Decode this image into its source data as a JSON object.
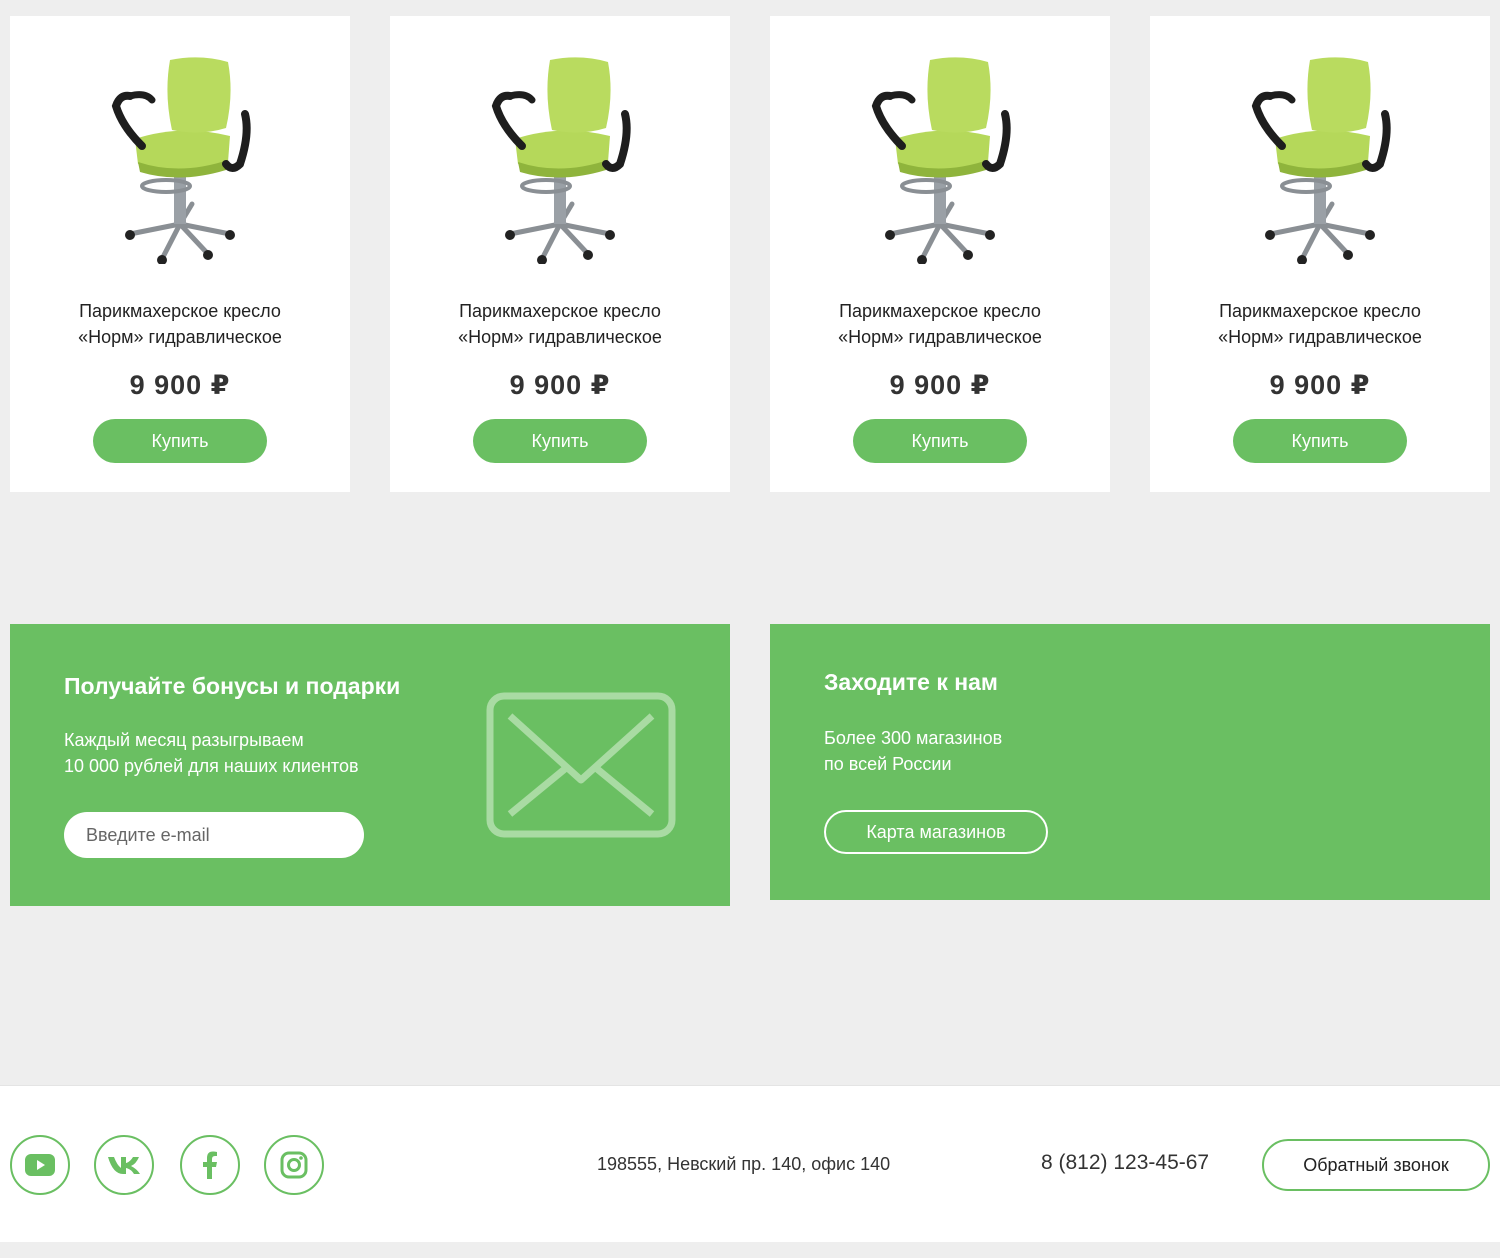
{
  "colors": {
    "accent": "#6abf62",
    "background": "#eeeeee"
  },
  "products": [
    {
      "title": "Парикмахерское кресло\n«Норм» гидравлическое",
      "price": "9 900 ₽",
      "buy_label": "Купить",
      "image": "green-chair-image"
    },
    {
      "title": "Парикмахерское кресло\n«Норм» гидравлическое",
      "price": "9 900 ₽",
      "buy_label": "Купить",
      "image": "green-chair-image"
    },
    {
      "title": "Парикмахерское кресло\n«Норм» гидравлическое",
      "price": "9 900 ₽",
      "buy_label": "Купить",
      "image": "green-chair-image"
    },
    {
      "title": "Парикмахерское кресло\n«Норм» гидравлическое",
      "price": "9 900 ₽",
      "buy_label": "Купить",
      "image": "green-chair-image"
    }
  ],
  "bonus_promo": {
    "title": "Получайте бонусы и подарки",
    "text": "Каждый месяц разыгрываем\n10 000 рублей для наших клиентов",
    "email_placeholder": "Введите e-mail",
    "icon": "envelope-icon"
  },
  "stores_promo": {
    "title": "Заходите к нам",
    "text": "Более 300 магазинов\nпо всей России",
    "button_label": "Карта магазинов"
  },
  "footer": {
    "social": [
      "youtube-icon",
      "vk-icon",
      "facebook-icon",
      "instagram-icon"
    ],
    "address": "198555, Невский пр. 140, офис 140",
    "phone": "8 (812) 123-45-67",
    "callback_label": "Обратный звонок"
  }
}
